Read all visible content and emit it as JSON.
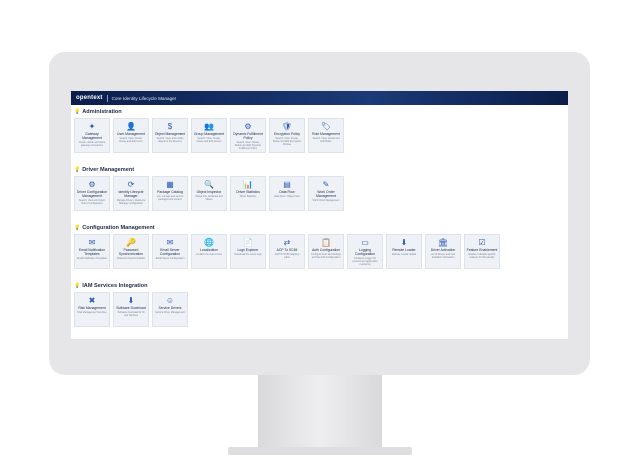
{
  "header": {
    "brand": "opentext",
    "app_title": "Core Identity Lifecycle Manager"
  },
  "sections": [
    {
      "title": "Administration",
      "items": [
        {
          "icon": "gateway-icon",
          "glyph": "✦",
          "label": "Gateway Management",
          "desc": "Create, delete and share gateway connections"
        },
        {
          "icon": "user-icon",
          "glyph": "👤",
          "label": "User Management",
          "desc": "Search, View, Create, Delete and Edit Users"
        },
        {
          "icon": "object-icon",
          "glyph": "$",
          "label": "Object Management",
          "desc": "Search, View, and modify objects in the directory"
        },
        {
          "icon": "group-icon",
          "glyph": "👥",
          "label": "Group Management",
          "desc": "Search, View, Create, Delete and Edit Groups"
        },
        {
          "icon": "fulfillment-icon",
          "glyph": "⚙",
          "label": "Dynamic Fulfillment Policy",
          "desc": "Search, View, Create, Delete and Edit Dynamic Fulfillment Policy"
        },
        {
          "icon": "encryption-icon",
          "glyph": "🛡",
          "label": "Encryption Policy",
          "desc": "Search, View, Create, Delete and Edit Encryption Policies"
        },
        {
          "icon": "role-icon",
          "glyph": "🏷",
          "label": "Role Management",
          "desc": "Search, View, Create and Edit Roles"
        }
      ]
    },
    {
      "title": "Driver Management",
      "items": [
        {
          "icon": "driver-config-icon",
          "glyph": "⚙",
          "label": "Driver Configuration Management",
          "desc": "Search, View and Import Driver Configuration"
        },
        {
          "icon": "lifecycle-icon",
          "glyph": "⟳",
          "label": "Identity Lifecycle Manager",
          "desc": "Manage Drivers, Resource Manager configuration"
        },
        {
          "icon": "package-icon",
          "glyph": "▦",
          "label": "Package Catalog",
          "desc": "List, manage and service packages and content"
        },
        {
          "icon": "inspector-icon",
          "glyph": "🔍",
          "label": "Object Inspector",
          "desc": "Object Info, Attributes and Values"
        },
        {
          "icon": "statistics-icon",
          "glyph": "📊",
          "label": "Driver Statistics",
          "desc": "Driver Statistics"
        },
        {
          "icon": "dataflow-icon",
          "glyph": "▤",
          "label": "Data Flow",
          "desc": "Data Flow / Object Flow"
        },
        {
          "icon": "workorder-icon",
          "glyph": "✎",
          "label": "Work Order Management",
          "desc": "Work Order Management"
        }
      ]
    },
    {
      "title": "Configuration Management",
      "items": [
        {
          "icon": "email-icon",
          "glyph": "✉",
          "label": "Email Notification Templates",
          "desc": "Email Notification Templates"
        },
        {
          "icon": "password-icon",
          "glyph": "🔑",
          "label": "Password Synchronization",
          "desc": "Password Synchronization"
        },
        {
          "icon": "email-server-icon",
          "glyph": "✉",
          "label": "Email Server Configuration",
          "desc": "Email Server Configuration"
        },
        {
          "icon": "globe-icon",
          "glyph": "🌐",
          "label": "Localization",
          "desc": "Localize the web service"
        },
        {
          "icon": "logs-icon",
          "glyph": "📄",
          "label": "Logs Explorer",
          "desc": "Download the server logs"
        },
        {
          "icon": "scim-icon",
          "glyph": "⇄",
          "label": "ACP To SCIM",
          "desc": "ACP To SCIM mapping editor"
        },
        {
          "icon": "auth-icon",
          "glyph": "📋",
          "label": "Auth Configuration",
          "desc": "Configure Auth and Settings and Set Auth Configuration"
        },
        {
          "icon": "logging-icon",
          "glyph": "▭",
          "label": "Logging Configuration",
          "desc": "Configure Logger for process and application monitoring"
        },
        {
          "icon": "remote-loader-icon",
          "glyph": "⬇",
          "label": "Remote Loader",
          "desc": "Remote Loader details"
        },
        {
          "icon": "driver-activation-icon",
          "glyph": "🏛",
          "label": "Driver Activation",
          "desc": "List of Drivers and their activation information"
        },
        {
          "icon": "feature-icon",
          "glyph": "☑",
          "label": "Feature Enablement",
          "desc": "Enable or disable specific features for this identity"
        }
      ]
    },
    {
      "title": "IAM Services Integration",
      "items": [
        {
          "icon": "risk-icon",
          "glyph": "✖",
          "label": "Risk Management",
          "desc": "Risk Management Services"
        },
        {
          "icon": "download-icon",
          "glyph": "⬇",
          "label": "Software Download",
          "desc": "Software download for ID and Services"
        },
        {
          "icon": "service-drivers-icon",
          "glyph": "☺",
          "label": "Service Drivers",
          "desc": "Service Driver Management"
        }
      ]
    }
  ]
}
